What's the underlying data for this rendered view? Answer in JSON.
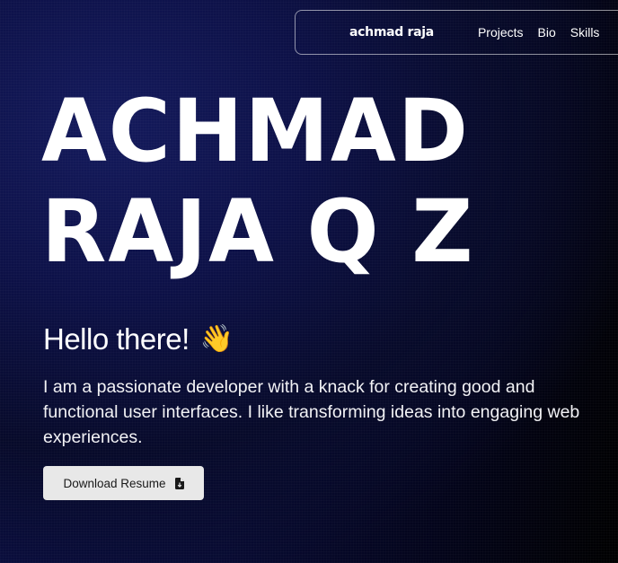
{
  "nav": {
    "brand": "achmad raja",
    "links": [
      "Projects",
      "Bio",
      "Skills"
    ]
  },
  "hero": {
    "title_line1": "ACHMAD",
    "title_line2": "RAJA Q Z",
    "greeting": "Hello there!",
    "wave_emoji": "👋",
    "intro": "I am a passionate developer with a knack for creating good and functional user interfaces. I like transforming ideas into engaging web experiences.",
    "resume_button": "Download Resume",
    "resume_icon": "file-download-icon"
  },
  "colors": {
    "background_dark": "#0b0f45",
    "button_bg": "#e8e8e8",
    "button_text": "#1a1a1a",
    "text": "#ffffff"
  }
}
